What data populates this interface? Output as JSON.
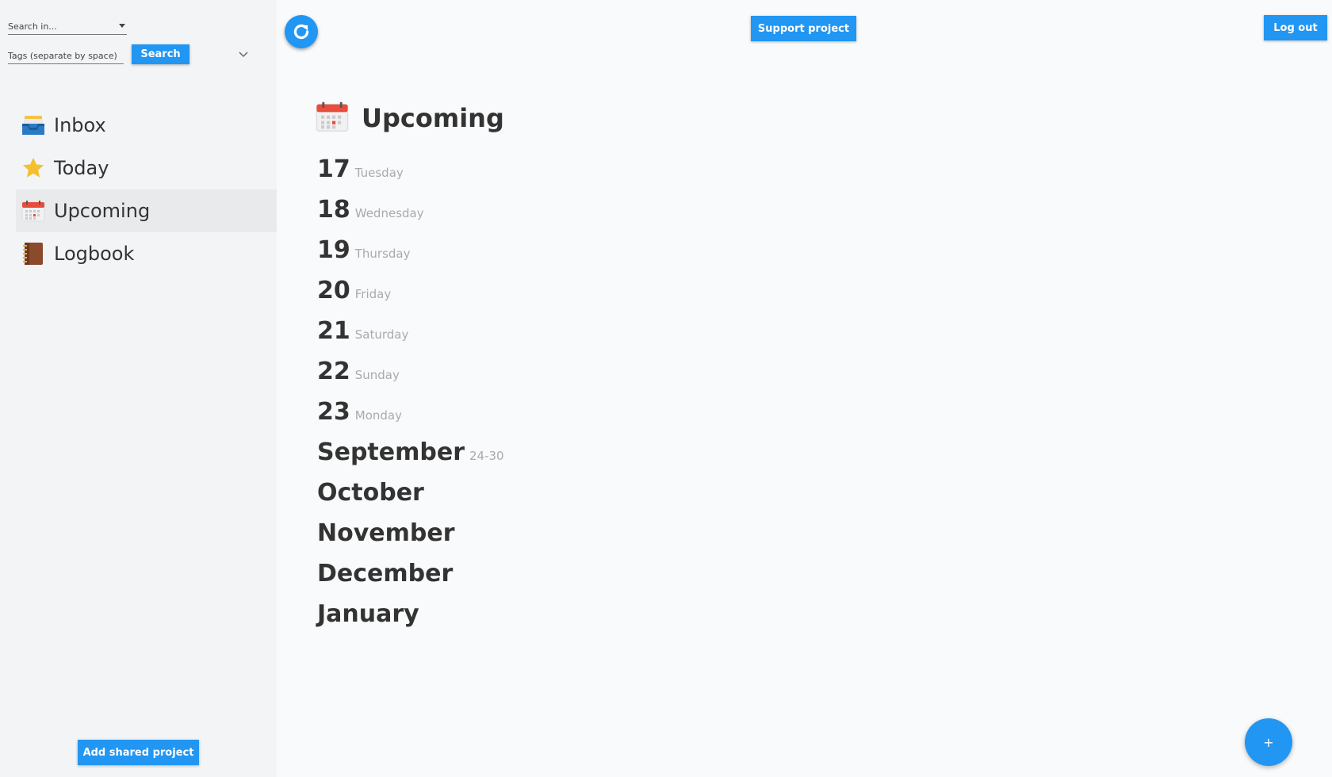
{
  "search": {
    "search_in_placeholder": "Search in...",
    "tags_placeholder": "Tags (separate by space)",
    "search_button": "Search"
  },
  "sidebar": {
    "items": [
      {
        "label": "Inbox",
        "icon": "inbox-tray-icon"
      },
      {
        "label": "Today",
        "icon": "star-icon"
      },
      {
        "label": "Upcoming",
        "icon": "calendar-icon",
        "active": true
      },
      {
        "label": "Logbook",
        "icon": "notebook-icon"
      }
    ],
    "add_shared_project": "Add shared project"
  },
  "header": {
    "support_project": "Support project",
    "log_out": "Log out"
  },
  "main": {
    "title": "Upcoming",
    "days": [
      {
        "num": "17",
        "name": "Tuesday"
      },
      {
        "num": "18",
        "name": "Wednesday"
      },
      {
        "num": "19",
        "name": "Thursday"
      },
      {
        "num": "20",
        "name": "Friday"
      },
      {
        "num": "21",
        "name": "Saturday"
      },
      {
        "num": "22",
        "name": "Sunday"
      },
      {
        "num": "23",
        "name": "Monday"
      }
    ],
    "months": [
      {
        "name": "September",
        "range": "24-30"
      },
      {
        "name": "October",
        "range": ""
      },
      {
        "name": "November",
        "range": ""
      },
      {
        "name": "December",
        "range": ""
      },
      {
        "name": "January",
        "range": ""
      }
    ]
  },
  "fab_label": "+",
  "colors": {
    "accent": "#2196f3",
    "sidebar_bg": "#f3f4f6",
    "main_bg": "#f9fafb",
    "active_item_bg": "#e9eaec"
  }
}
